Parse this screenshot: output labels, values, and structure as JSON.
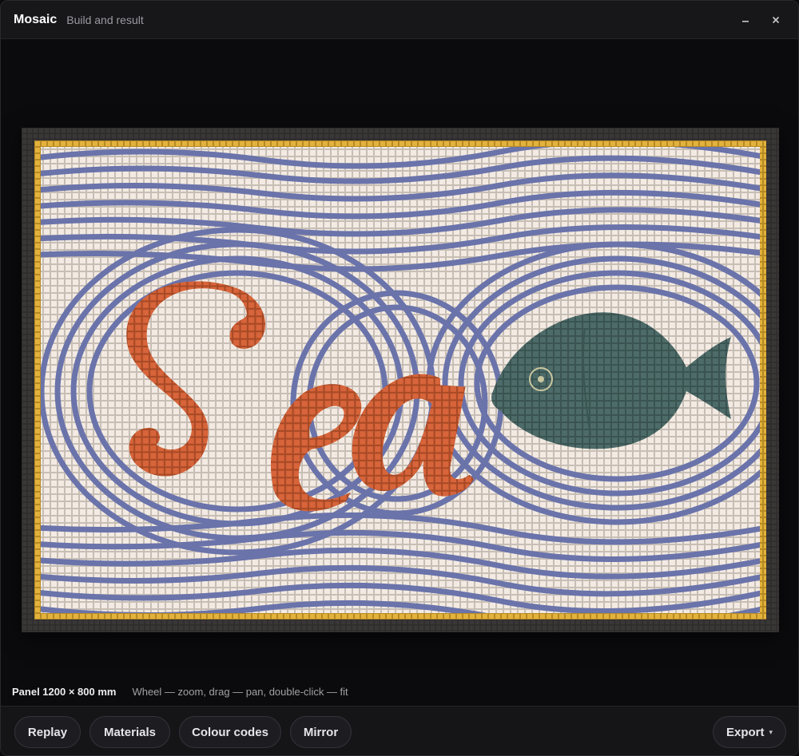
{
  "window": {
    "title": "Mosaic",
    "subtitle": "Build and result",
    "minimize_icon": "minimize-icon",
    "close_icon": "close-icon"
  },
  "artwork": {
    "word": "Sea",
    "colors": {
      "frame": "#2e2c2b",
      "grout": "#5a5656",
      "border": "#e3b23c",
      "tessera_light": "#f3ebe3",
      "tessera_blue": "#6a73aa",
      "letters": "#d7643a",
      "fish": "#4d6b68",
      "fish_eye": "#c9c6a0"
    }
  },
  "status": {
    "panel_size": "Panel 1200 × 800 mm",
    "hint": "Wheel — zoom, drag — pan, double-click — fit"
  },
  "toolbar": {
    "replay": "Replay",
    "materials": "Materials",
    "colour_codes": "Colour codes",
    "mirror": "Mirror",
    "export": "Export",
    "export_caret": "▾"
  }
}
